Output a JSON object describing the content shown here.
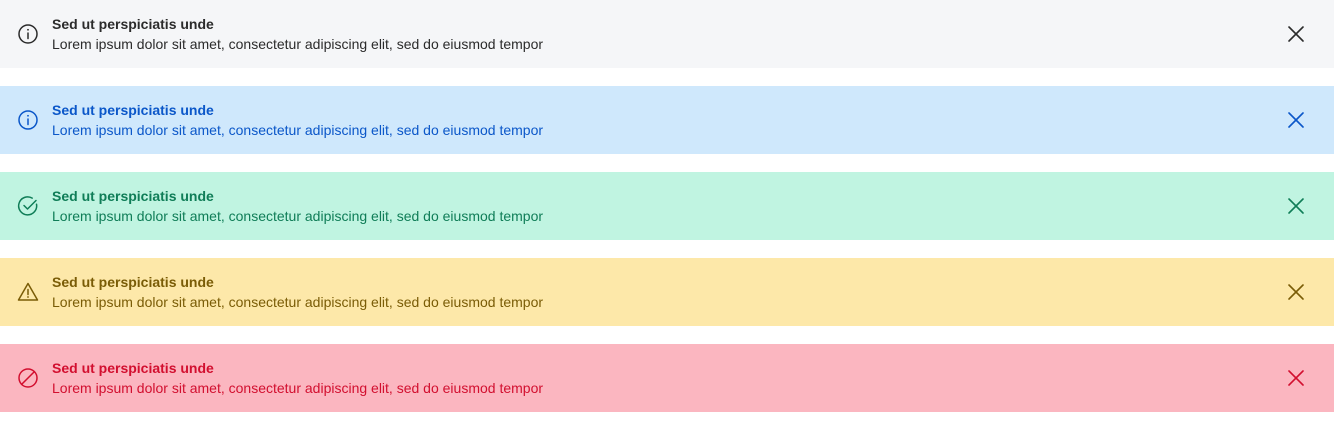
{
  "banners": [
    {
      "variant": "neutral",
      "icon": "info-icon",
      "title": "Sed ut perspiciatis unde",
      "message": "Lorem ipsum dolor sit amet, consectetur adipiscing elit, sed do eiusmod tempor",
      "colors": {
        "background": "#f5f6f8",
        "title": "#2b2b2b",
        "text": "#2b2b2b",
        "icon": "#2b2b2b"
      }
    },
    {
      "variant": "info",
      "icon": "info-icon",
      "title": "Sed ut perspiciatis unde",
      "message": "Lorem ipsum dolor sit amet, consectetur adipiscing elit, sed do eiusmod tempor",
      "colors": {
        "background": "#cfe8fc",
        "title": "#0b57c9",
        "text": "#0b57c9",
        "icon": "#0b57c9"
      }
    },
    {
      "variant": "success",
      "icon": "check-circle-icon",
      "title": "Sed ut perspiciatis unde",
      "message": "Lorem ipsum dolor sit amet, consectetur adipiscing elit, sed do eiusmod tempor",
      "colors": {
        "background": "#c0f4e1",
        "title": "#0f7d57",
        "text": "#0f7d57",
        "icon": "#0f7d57"
      }
    },
    {
      "variant": "warning",
      "icon": "warning-triangle-icon",
      "title": "Sed ut perspiciatis unde",
      "message": "Lorem ipsum dolor sit amet, consectetur adipiscing elit, sed do eiusmod tempor",
      "colors": {
        "background": "#fde8a9",
        "title": "#7a5c06",
        "text": "#7a5c06",
        "icon": "#7a5c06"
      }
    },
    {
      "variant": "error",
      "icon": "prohibited-icon",
      "title": "Sed ut perspiciatis unde",
      "message": "Lorem ipsum dolor sit amet, consectetur adipiscing elit, sed do eiusmod tempor",
      "colors": {
        "background": "#fbb6c0",
        "title": "#d20f2f",
        "text": "#d20f2f",
        "icon": "#d20f2f"
      }
    }
  ]
}
